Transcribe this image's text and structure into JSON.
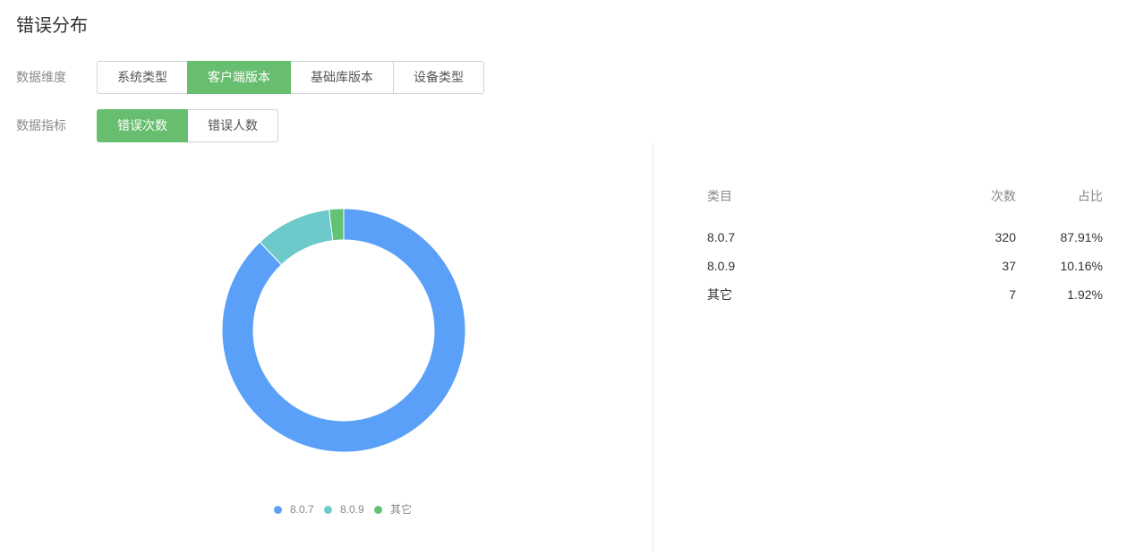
{
  "page": {
    "title": "错误分布"
  },
  "filters": {
    "dimension": {
      "label": "数据维度",
      "options": [
        {
          "label": "系统类型",
          "active": false
        },
        {
          "label": "客户端版本",
          "active": true
        },
        {
          "label": "基础库版本",
          "active": false
        },
        {
          "label": "设备类型",
          "active": false
        }
      ]
    },
    "metric": {
      "label": "数据指标",
      "options": [
        {
          "label": "错误次数",
          "active": true
        },
        {
          "label": "错误人数",
          "active": false
        }
      ]
    }
  },
  "colors": {
    "accent": "#66be6e",
    "series": [
      "#5aa0f8",
      "#6dc9ca",
      "#63c274"
    ]
  },
  "chart_data": {
    "type": "pie",
    "donut": true,
    "categories": [
      "8.0.7",
      "8.0.9",
      "其它"
    ],
    "values": [
      320,
      37,
      7
    ],
    "legend": "bottom"
  },
  "table": {
    "headers": [
      "类目",
      "次数",
      "占比"
    ],
    "rows": [
      [
        "8.0.7",
        "320",
        "87.91%"
      ],
      [
        "8.0.9",
        "37",
        "10.16%"
      ],
      [
        "其它",
        "7",
        "1.92%"
      ]
    ]
  }
}
